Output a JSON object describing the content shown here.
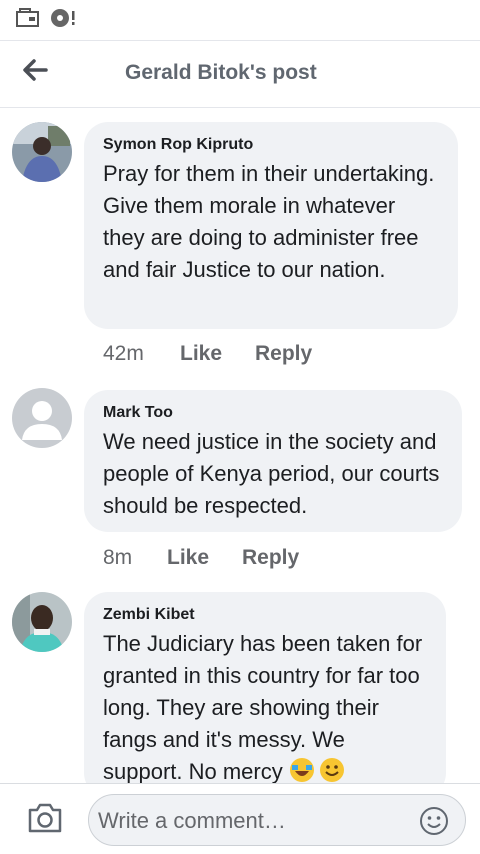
{
  "status_bar": {
    "icons": [
      "wallet-icon",
      "music-note-icon"
    ]
  },
  "header": {
    "title": "Gerald Bitok's post",
    "back_icon": "arrow-left-icon"
  },
  "comments": [
    {
      "author": "Symon Rop Kipruto",
      "text": "Pray for them in their undertaking. Give them morale in whatever they are doing to administer free and fair Justice to our nation.",
      "time": "42m",
      "like": "Like",
      "reply": "Reply"
    },
    {
      "author": "Mark Too",
      "text": "We need justice in the society and people of Kenya period, our courts should be respected.",
      "time": "8m",
      "like": "Like",
      "reply": "Reply"
    },
    {
      "author": "Zembi Kibet",
      "text": "The Judiciary has been taken for granted in this country for far too long. They are showing their fangs and it's messy. We support. No mercy",
      "time": "",
      "like": "",
      "reply": ""
    }
  ],
  "composer": {
    "placeholder": "Write a comment…",
    "camera_icon": "camera-icon",
    "emoji_icon": "smiley-icon"
  },
  "colors": {
    "bubble": "#f0f2f5",
    "secondary_text": "#65676b",
    "title_text": "#606770"
  }
}
